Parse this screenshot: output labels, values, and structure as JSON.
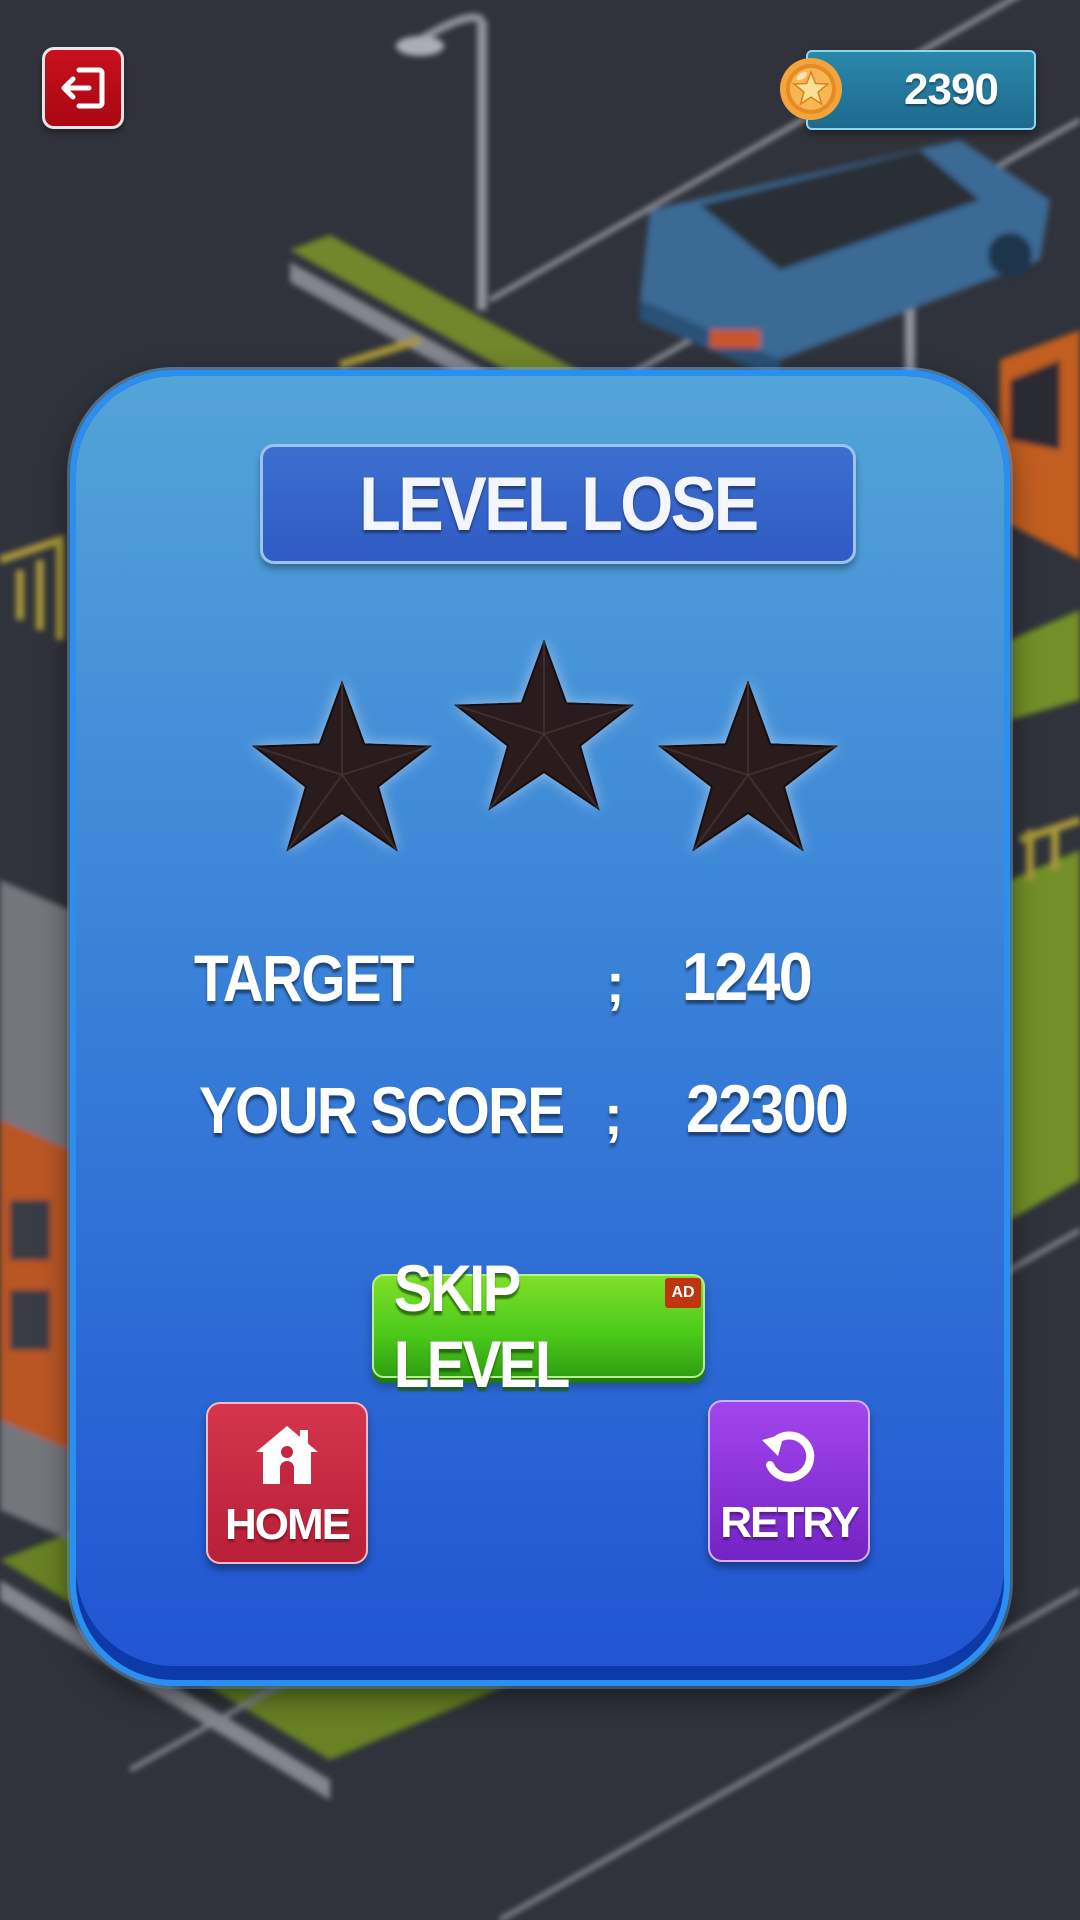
{
  "top_bar": {
    "exit_icon": "exit-door-icon",
    "coin_icon": "star-coin-icon",
    "coins": "2390"
  },
  "dialog": {
    "title": "LEVEL LOSE",
    "stars": {
      "earned": 0,
      "total": 3,
      "icon": "star-icon"
    },
    "rows": [
      {
        "label": "TARGET",
        "separator": ";",
        "value": "1240"
      },
      {
        "label": "YOUR SCORE",
        "separator": ";",
        "value": "22300"
      }
    ],
    "skip_button": {
      "label": "SKIP LEVEL",
      "badge": "AD"
    },
    "home_button": {
      "label": "HOME",
      "icon": "home-icon"
    },
    "retry_button": {
      "label": "RETRY",
      "icon": "retry-icon"
    }
  },
  "colors": {
    "card_top": "#53a4d8",
    "card_bottom": "#2155d2",
    "skip_green": "#4ac81a",
    "home_red": "#c8293f",
    "retry_purple": "#8b33dc",
    "star_empty": "#2a1a1c"
  }
}
